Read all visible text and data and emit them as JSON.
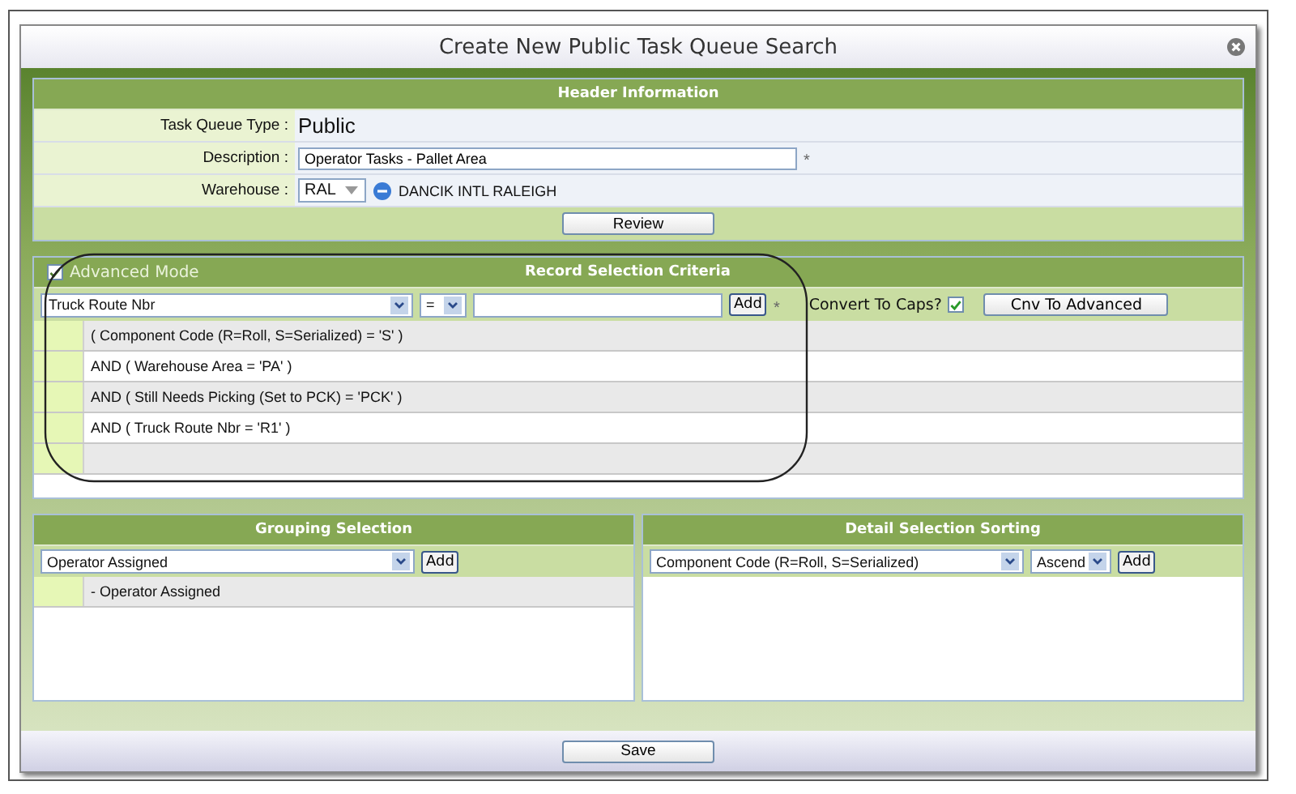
{
  "dialog": {
    "title": "Create New Public Task Queue Search"
  },
  "header": {
    "title": "Header Information",
    "fields": [
      {
        "label": "Task Queue Type :",
        "kind": "static",
        "value": "Public"
      },
      {
        "label": "Description :",
        "kind": "input",
        "value": "Operator Tasks - Pallet Area",
        "mark": "*"
      },
      {
        "label": "Warehouse :",
        "kind": "select",
        "value": "RAL",
        "note": "DANCIK INTL RALEIGH"
      }
    ],
    "button": "Review"
  },
  "criteria": {
    "title": "Record Selection Criteria",
    "advanced_mode": {
      "label": "Advanced Mode",
      "checked": true
    },
    "field_select": "Truck Route Nbr",
    "operator_select": "=",
    "add_button": "Add",
    "mark": "*",
    "caps": {
      "label": "Convert To Caps?",
      "checked": true
    },
    "convert_button": "Cnv To Advanced",
    "rows": [
      "( Component Code (R=Roll, S=Serialized) = 'S' )",
      "AND  ( Warehouse Area = 'PA' )",
      "AND  ( Still Needs Picking (Set to PCK) = 'PCK' )",
      "AND  ( Truck Route Nbr = 'R1' )"
    ]
  },
  "grouping": {
    "title": "Grouping Selection",
    "select": "Operator Assigned",
    "add_button": "Add",
    "rows": [
      "- Operator Assigned"
    ]
  },
  "sorting": {
    "title": "Detail Selection Sorting",
    "select": "Component Code (R=Roll, S=Serialized)",
    "order_select": "Ascend",
    "add_button": "Add"
  },
  "save_button": "Save"
}
